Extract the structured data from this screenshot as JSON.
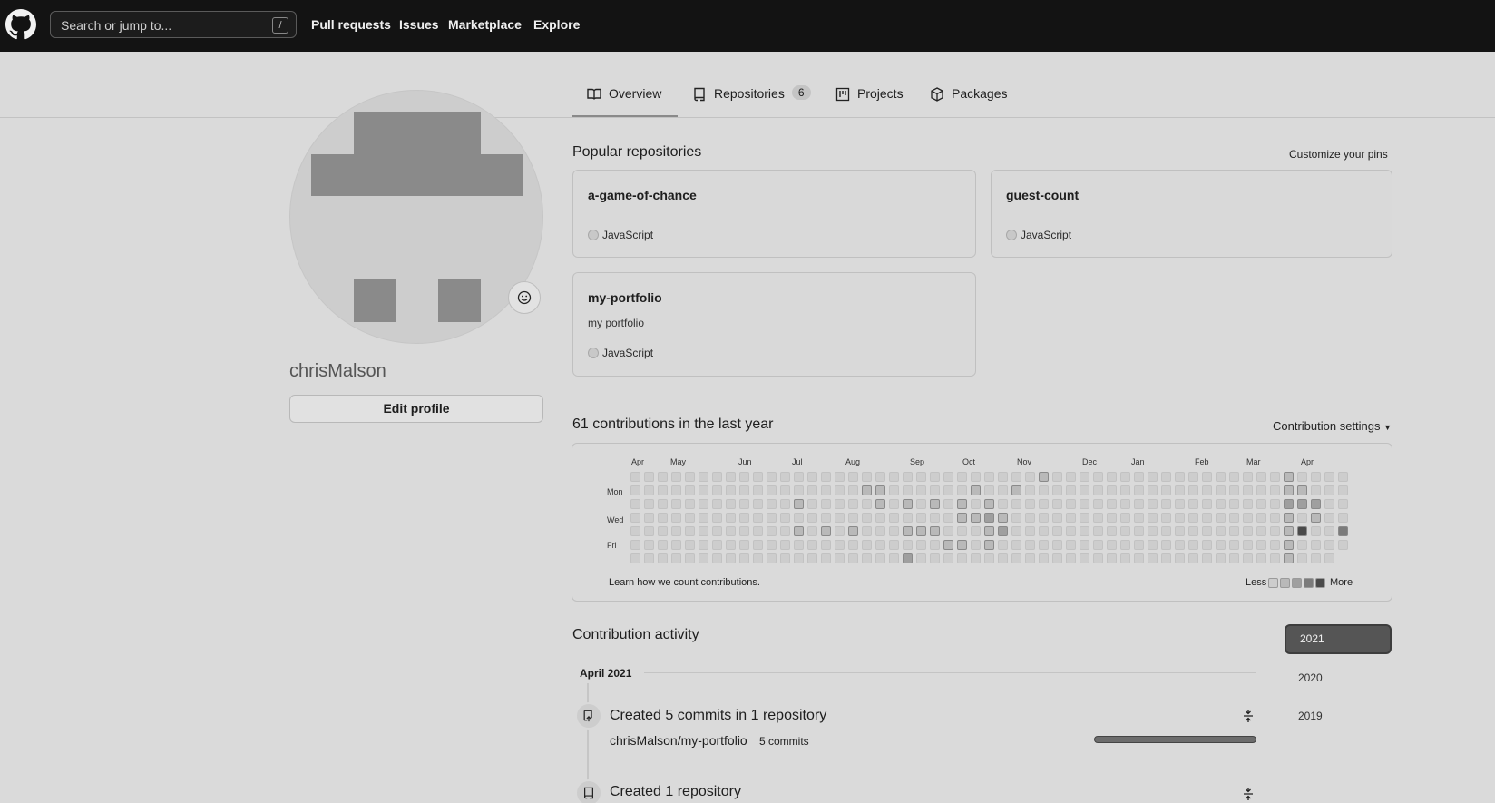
{
  "nav": {
    "search_placeholder": "Search or jump to...",
    "slash_key": "/",
    "links": [
      "Pull requests",
      "Issues",
      "Marketplace",
      "Explore"
    ]
  },
  "tabs": [
    {
      "label": "Overview",
      "icon": "book-icon",
      "active": true
    },
    {
      "label": "Repositories",
      "icon": "repo-icon",
      "count": "6"
    },
    {
      "label": "Projects",
      "icon": "project-icon"
    },
    {
      "label": "Packages",
      "icon": "package-icon"
    }
  ],
  "profile": {
    "username": "chrisMalson",
    "edit_label": "Edit profile"
  },
  "pinned": {
    "title": "Popular repositories",
    "customize": "Customize your pins",
    "repos": [
      {
        "name": "a-game-of-chance",
        "description": "",
        "language": "JavaScript"
      },
      {
        "name": "guest-count",
        "description": "",
        "language": "JavaScript"
      },
      {
        "name": "my-portfolio",
        "description": "my portfolio",
        "language": "JavaScript"
      }
    ]
  },
  "contributions": {
    "title": "61 contributions in the last year",
    "settings": "Contribution settings",
    "months": [
      "Apr",
      "May",
      "Jun",
      "Jul",
      "Aug",
      "Sep",
      "Oct",
      "Nov",
      "Dec",
      "Jan",
      "Feb",
      "Mar",
      "Apr"
    ],
    "days": [
      "Mon",
      "Wed",
      "Fri"
    ],
    "learn": "Learn how we count contributions.",
    "less": "Less",
    "more": "More",
    "levels": [
      "#cdcdcd",
      "#b9b9b9",
      "#9f9f9f",
      "#7b7b7b",
      "#4a4a4a"
    ]
  },
  "activity": {
    "title": "Contribution activity",
    "years": [
      "2021",
      "2020",
      "2019"
    ],
    "period": "April 2021",
    "items": [
      {
        "title": "Created 5 commits in 1 repository",
        "repo": "chrisMalson/my-portfolio",
        "commits": "5 commits"
      },
      {
        "title": "Created 1 repository"
      }
    ]
  }
}
